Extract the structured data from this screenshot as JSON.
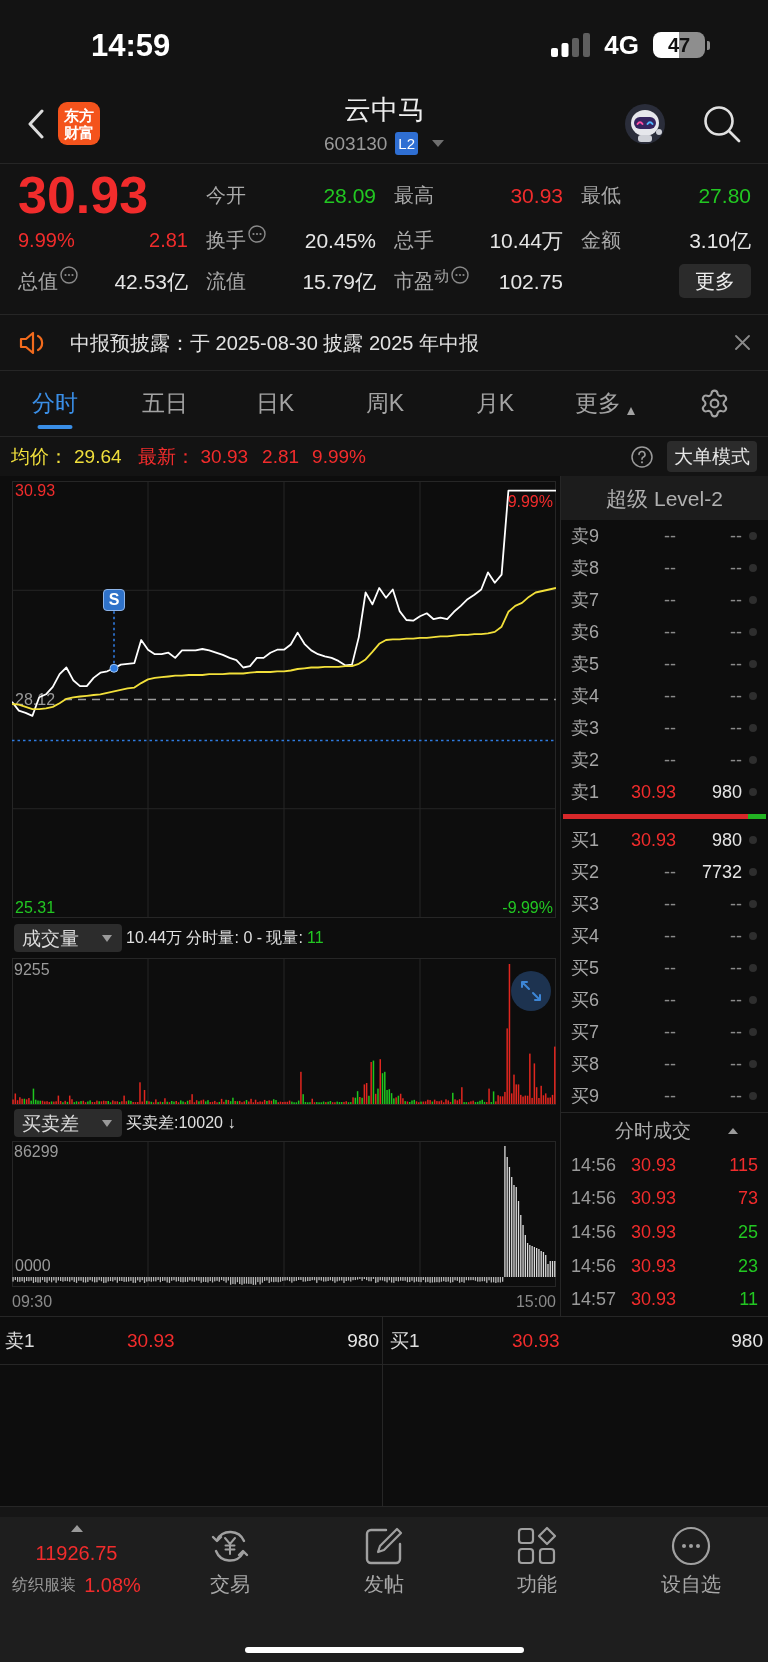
{
  "status_bar": {
    "time": "14:59",
    "network": "4G",
    "battery": "47"
  },
  "nav": {
    "logo": "东方财富",
    "title": "云中马",
    "code": "603130",
    "badge": "L2"
  },
  "quote": {
    "price": "30.93",
    "change_pct": "9.99%",
    "change": "2.81",
    "total_value": {
      "label": "总值",
      "value": "42.53亿",
      "info": true
    },
    "stats": [
      {
        "label": "今开",
        "value": "28.09",
        "color": "#22c722",
        "info": false
      },
      {
        "label": "最高",
        "value": "30.93",
        "color": "#f12c2c",
        "info": false
      },
      {
        "label": "最低",
        "value": "27.80",
        "color": "#22c722",
        "info": false
      },
      {
        "label": "换手",
        "value": "20.45%",
        "color": "#e6e6e6",
        "info": true
      },
      {
        "label": "总手",
        "value": "10.44万",
        "color": "#e6e6e6",
        "info": false
      },
      {
        "label": "金额",
        "value": "3.10亿",
        "color": "#e6e6e6",
        "info": false
      },
      {
        "label": "流值",
        "value": "15.79亿",
        "color": "#e6e6e6",
        "info": false
      },
      {
        "label": "市盈$^{动}$",
        "value": "102.75",
        "color": "#e6e6e6",
        "info": true
      }
    ],
    "more_button": "更多"
  },
  "notice": {
    "text": "中报预披露：于 2025-08-30 披露 2025 年中报"
  },
  "tabs": [
    {
      "label": "分时",
      "selected": true,
      "kind": "plain"
    },
    {
      "label": "五日",
      "selected": false,
      "kind": "plain"
    },
    {
      "label": "日K",
      "selected": false,
      "kind": "plain"
    },
    {
      "label": "周K",
      "selected": false,
      "kind": "plain"
    },
    {
      "label": "月K",
      "selected": false,
      "kind": "plain"
    },
    {
      "label": "更多",
      "selected": false,
      "kind": "menu"
    }
  ],
  "price_line": {
    "avg_label": "均价：",
    "avg": "29.64",
    "latest_label": "最新：",
    "latest": "30.93",
    "change": "2.81",
    "change_pct": "9.99%",
    "mode_button": "大单模式"
  },
  "price_chart": {
    "pct_ticks": [
      "9.99%",
      "-9.99%"
    ],
    "marker": "S",
    "chart_data": {
      "type": "line",
      "categories": [
        null,
        null,
        null,
        null,
        null,
        null,
        null,
        null,
        null,
        null,
        null,
        null,
        null,
        null,
        null,
        null,
        null,
        null,
        null,
        null,
        null,
        null,
        null,
        null,
        null,
        null,
        null,
        null,
        null,
        null,
        null,
        null,
        null,
        null,
        null,
        null,
        null,
        null,
        null,
        null,
        null,
        null,
        null,
        null,
        null,
        null,
        null,
        null,
        null,
        null,
        null,
        null,
        null,
        null,
        null,
        null,
        null,
        null,
        null,
        null,
        null,
        null,
        null,
        null,
        null,
        null,
        null,
        null,
        null,
        null,
        null,
        null,
        null,
        null,
        null,
        null,
        null,
        null,
        null,
        null,
        null
      ],
      "series": [
        {
          "color": "#ffffff",
          "values": [
            28.09,
            27.97,
            27.94,
            27.9,
            28.15,
            28.19,
            28.29,
            28.46,
            28.55,
            28.38,
            28.3,
            28.3,
            28.41,
            28.48,
            28.5,
            28.54,
            28.59,
            28.6,
            28.61,
            28.92,
            28.79,
            28.73,
            28.73,
            28.75,
            28.68,
            28.78,
            28.78,
            28.78,
            28.8,
            28.78,
            28.75,
            28.72,
            28.68,
            28.65,
            28.55,
            28.57,
            28.68,
            28.68,
            28.75,
            28.79,
            28.79,
            28.86,
            29.02,
            28.87,
            28.78,
            28.73,
            28.7,
            28.68,
            28.64,
            28.58,
            28.59,
            28.96,
            29.56,
            29.4,
            29.62,
            29.49,
            29.6,
            29.31,
            29.19,
            29.18,
            29.24,
            29.28,
            29.2,
            29.22,
            29.2,
            29.3,
            29.38,
            29.47,
            29.53,
            29.6,
            29.83,
            29.69,
            29.8,
            30.93,
            30.93,
            30.93,
            30.93,
            30.93,
            30.93,
            30.93,
            30.93
          ]
        },
        {
          "color": "#f2e03a",
          "values": [
            28.06,
            28.05,
            28.02,
            27.99,
            27.99,
            28.0,
            28.02,
            28.07,
            28.13,
            28.15,
            28.16,
            28.17,
            28.18,
            28.19,
            28.21,
            28.23,
            28.25,
            28.27,
            28.28,
            28.34,
            28.39,
            28.41,
            28.42,
            28.43,
            28.44,
            28.44,
            28.45,
            28.45,
            28.45,
            28.46,
            28.46,
            28.46,
            28.47,
            28.47,
            28.47,
            28.48,
            28.49,
            28.49,
            28.49,
            28.5,
            28.5,
            28.51,
            28.53,
            28.54,
            28.55,
            28.55,
            28.56,
            28.56,
            28.56,
            28.57,
            28.57,
            28.6,
            28.66,
            28.76,
            28.87,
            28.92,
            28.93,
            28.93,
            28.94,
            28.94,
            28.95,
            28.95,
            28.96,
            28.97,
            28.97,
            28.98,
            28.99,
            28.99,
            29.0,
            29.0,
            29.01,
            29.03,
            29.1,
            29.3,
            29.38,
            29.42,
            29.5,
            29.56,
            29.58,
            29.6,
            29.62
          ]
        }
      ],
      "ylim": [
        25.18,
        31.06
      ],
      "yticks": [
        {
          "value": 30.93,
          "label": "30.93"
        },
        {
          "value": 28.12,
          "label": "28.12"
        },
        {
          "value": 25.31,
          "label": "25.31"
        }
      ],
      "grid": true,
      "ref_lines": [
        {
          "axis": "y",
          "value": 28.12,
          "color": "#9a9a9a"
        },
        {
          "axis": "y",
          "value": 27.57,
          "color": "#2f7be0"
        }
      ]
    }
  },
  "volume": {
    "selector": "成交量",
    "summary": "10.44万 分时量: 0 - 现量:",
    "current": "11",
    "max_label": "9255"
  },
  "buy_sell": {
    "selector": "买卖差",
    "summary": "买卖差:10020 ↓",
    "max_label": "86299",
    "zero_label": "0000"
  },
  "time_axis": [
    "09:30",
    "15:00"
  ],
  "order_book": {
    "title": "超级 Level-2",
    "asks": [
      {
        "label": "卖9",
        "price": "--",
        "volume": "--",
        "kind": "empty"
      },
      {
        "label": "卖8",
        "price": "--",
        "volume": "--",
        "kind": "empty"
      },
      {
        "label": "卖7",
        "price": "--",
        "volume": "--",
        "kind": "empty"
      },
      {
        "label": "卖6",
        "price": "--",
        "volume": "--",
        "kind": "empty"
      },
      {
        "label": "卖5",
        "price": "--",
        "volume": "--",
        "kind": "empty"
      },
      {
        "label": "卖4",
        "price": "--",
        "volume": "--",
        "kind": "empty"
      },
      {
        "label": "卖3",
        "price": "--",
        "volume": "--",
        "kind": "empty"
      },
      {
        "label": "卖2",
        "price": "--",
        "volume": "--",
        "kind": "empty"
      },
      {
        "label": "卖1",
        "price": "30.93",
        "volume": "980",
        "kind": "quoted"
      }
    ],
    "ratio": {
      "level": 0.91
    },
    "bids": [
      {
        "label": "买1",
        "price": "30.93",
        "volume": "980",
        "kind": "quoted"
      },
      {
        "label": "买2",
        "price": "--",
        "volume": "7732",
        "kind": "volume"
      },
      {
        "label": "买3",
        "price": "--",
        "volume": "--",
        "kind": "empty"
      },
      {
        "label": "买4",
        "price": "--",
        "volume": "--",
        "kind": "empty"
      },
      {
        "label": "买5",
        "price": "--",
        "volume": "--",
        "kind": "empty"
      },
      {
        "label": "买6",
        "price": "--",
        "volume": "--",
        "kind": "empty"
      },
      {
        "label": "买7",
        "price": "--",
        "volume": "--",
        "kind": "empty"
      },
      {
        "label": "买8",
        "price": "--",
        "volume": "--",
        "kind": "empty"
      },
      {
        "label": "买9",
        "price": "--",
        "volume": "--",
        "kind": "empty"
      }
    ]
  },
  "trades": {
    "title": "分时成交",
    "rows": [
      {
        "time": "14:56",
        "price": "30.93",
        "volume": "115",
        "color": "#f12c2c"
      },
      {
        "time": "14:56",
        "price": "30.93",
        "volume": "73",
        "color": "#f12c2c"
      },
      {
        "time": "14:56",
        "price": "30.93",
        "volume": "25",
        "color": "#22c722"
      },
      {
        "time": "14:56",
        "price": "30.93",
        "volume": "23",
        "color": "#22c722"
      },
      {
        "time": "14:57",
        "price": "30.93",
        "volume": "11",
        "color": "#22c722"
      }
    ]
  },
  "best_quotes": [
    {
      "label": "卖1",
      "price": "30.93",
      "volume": "980"
    },
    {
      "label": "买1",
      "price": "30.93",
      "volume": "980"
    }
  ],
  "bottom_nav": {
    "index": {
      "value": "11926.75",
      "name": "纺织服装",
      "change_pct": "1.08%"
    },
    "items": [
      {
        "label": "交易",
        "kind": "trade"
      },
      {
        "label": "发帖",
        "kind": "post"
      },
      {
        "label": "功能",
        "kind": "apps"
      },
      {
        "label": "设自选",
        "kind": "watch"
      }
    ]
  }
}
